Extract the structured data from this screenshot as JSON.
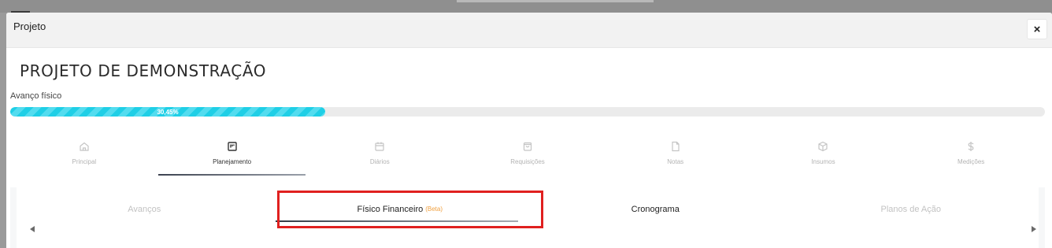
{
  "modal": {
    "title": "Projeto",
    "close_label": "×"
  },
  "project": {
    "name": "PROJETO DE DEMONSTRAÇÃO",
    "progress_label": "Avanço físico",
    "progress_value": 30.45,
    "progress_text": "30,45%"
  },
  "main_tabs": [
    {
      "label": "Principal",
      "icon": "home-icon",
      "active": false
    },
    {
      "label": "Planejamento",
      "icon": "kanban-icon",
      "active": true
    },
    {
      "label": "Diários",
      "icon": "calendar-icon",
      "active": false
    },
    {
      "label": "Requisições",
      "icon": "shopping-bag-icon",
      "active": false
    },
    {
      "label": "Notas",
      "icon": "file-icon",
      "active": false
    },
    {
      "label": "Insumos",
      "icon": "box-icon",
      "active": false
    },
    {
      "label": "Medições",
      "icon": "dollar-icon",
      "active": false
    }
  ],
  "sub_tabs": [
    {
      "label": "Avanços",
      "badge": ""
    },
    {
      "label": "Físico Financeiro",
      "badge": "(Beta)",
      "active": true
    },
    {
      "label": "Cronograma",
      "badge": ""
    },
    {
      "label": "Planos de Ação",
      "badge": ""
    }
  ],
  "colors": {
    "progress": "#1fcfe6",
    "highlight": "#e0201f",
    "beta": "#f0a040"
  }
}
